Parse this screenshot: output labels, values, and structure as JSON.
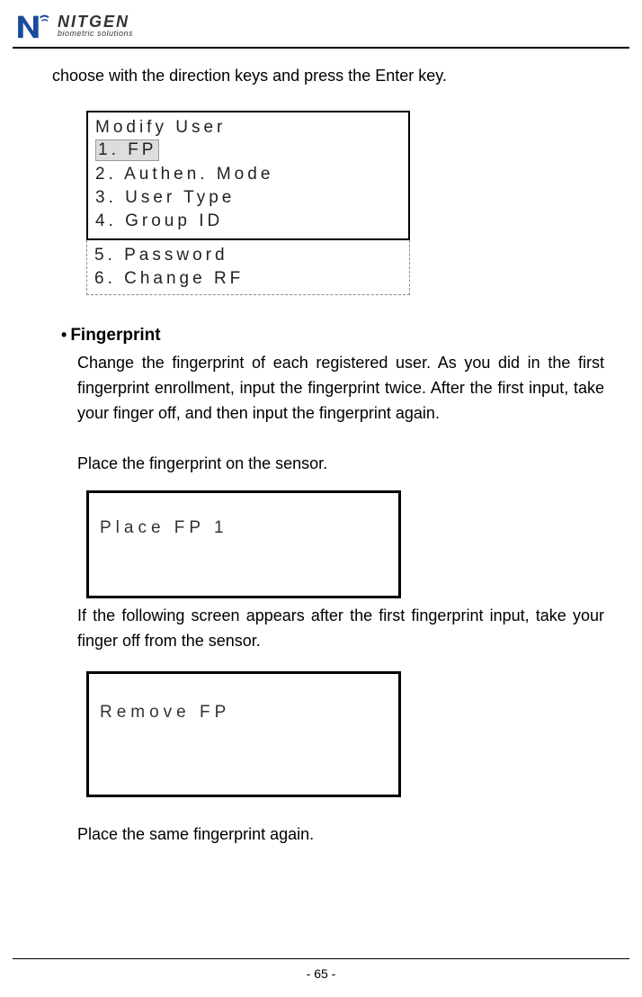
{
  "logo": {
    "main": "NITGEN",
    "sub": "biometric solutions"
  },
  "intro": "choose with the direction keys and press the Enter key.",
  "menu": {
    "title": "Modify User",
    "items_top": [
      "1. FP",
      "2. Authen.  Mode",
      "3. User Type",
      "4. Group ID"
    ],
    "items_bottom": [
      "5. Password",
      "6. Change RF"
    ],
    "selected_index": 0
  },
  "section": {
    "heading": "Fingerprint",
    "body": "Change the fingerprint of each registered user. As you did in the first fingerprint enrollment, input the fingerprint twice. After the first input, take your finger off, and then input the fingerprint again."
  },
  "instruction1": "Place the fingerprint on the sensor.",
  "lcd1": "Place FP 1",
  "after_lcd1": "If the following screen appears after the first fingerprint input, take your finger off from the sensor.",
  "lcd2": "Remove FP",
  "instruction2": "Place the same fingerprint again.",
  "page_number": "- 65 -"
}
